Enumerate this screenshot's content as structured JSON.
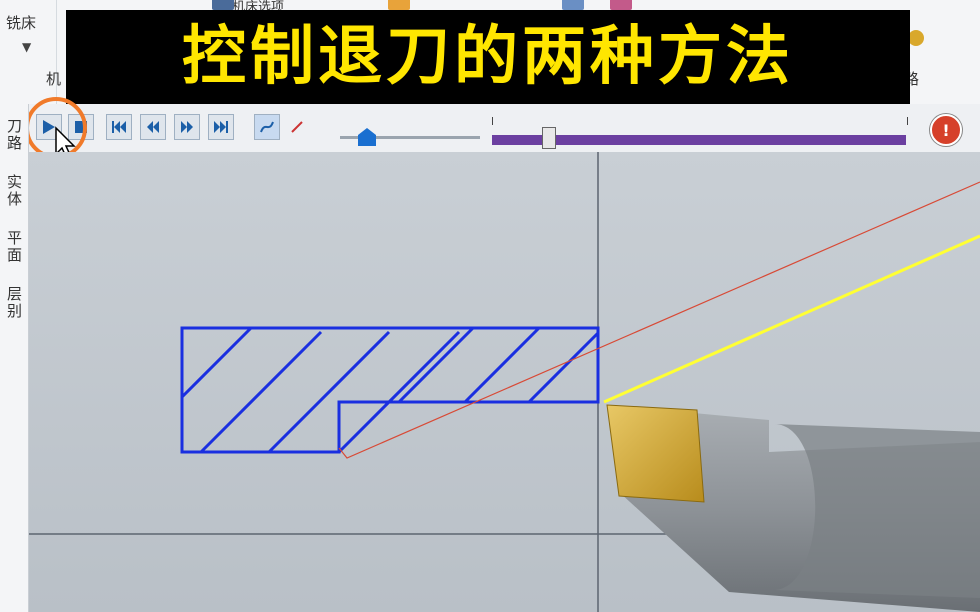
{
  "ribbon": {
    "milling_label": "铣床",
    "machine_label": "机",
    "change_label": "机床选项",
    "misc_label": "路"
  },
  "title": {
    "text": "控制退刀的两种方法"
  },
  "toolbar": {
    "play_icon": "play-icon",
    "stop_icon": "stop-icon",
    "first_icon": "skip-first-icon",
    "prev_icon": "step-back-icon",
    "next_icon": "step-forward-icon",
    "last_icon": "skip-last-icon",
    "progress_fraction": 0.15
  },
  "side_tabs": {
    "tab1": "刀路",
    "tab2": "实体",
    "tab3": "平面",
    "tab4": "层别"
  },
  "colors": {
    "title_bg": "#000000",
    "title_text": "#ffe600",
    "highlight_ring": "#f07a2a",
    "progress_bar": "#6b3fa0",
    "part_outline": "#1a2fe0",
    "toolpath_line": "#ffff33",
    "retract_line": "#d84a36",
    "tool_insert": "#d4a832"
  }
}
